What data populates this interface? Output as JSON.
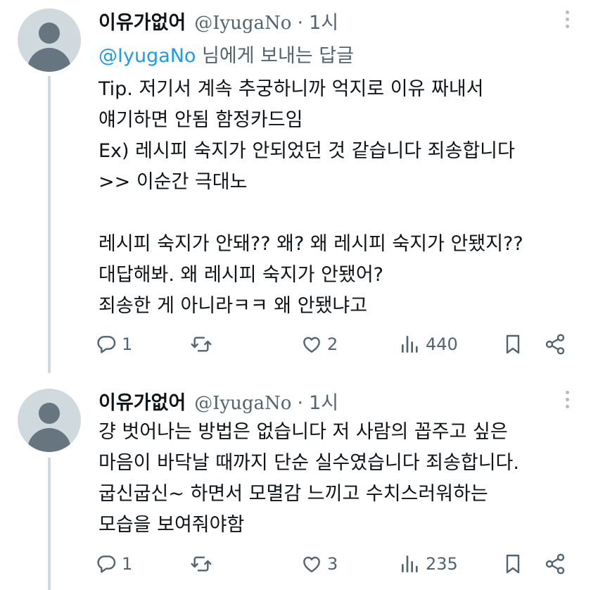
{
  "tweets": [
    {
      "author_name": "이유가없어",
      "author_handle": "@IyugaNo",
      "separator": "·",
      "time": "1시",
      "replying_to_mention": "@IyugaNo",
      "replying_to_suffix": " 님에게 보내는 답글",
      "lines": [
        "Tip. 저기서 계속 추궁하니까 억지로 이유 짜내서",
        "얘기하면 안됨 함정카드임",
        "Ex) 레시피 숙지가 안되었던 것 같습니다 죄송합니다",
        ">> 이순간 극대노",
        "",
        "레시피 숙지가 안돼?? 왜? 왜 레시피 숙지가 안됐지??",
        "대답해봐. 왜 레시피 숙지가 안됐어?",
        "죄송한 게 아니라ㅋㅋ 왜 안됐냐고"
      ],
      "replies": "1",
      "retweets": "",
      "likes": "2",
      "views": "440"
    },
    {
      "author_name": "이유가없어",
      "author_handle": "@IyugaNo",
      "separator": "·",
      "time": "1시",
      "lines": [
        "걍 벗어나는 방법은 없습니다 저 사람의 꼽주고 싶은",
        "마음이 바닥날 때까지 단순 실수였습니다 죄송합니다.",
        "굽신굽신~ 하면서 모멸감 느끼고 수치스러워하는",
        "모습을 보여줘야함"
      ],
      "replies": "1",
      "retweets": "",
      "likes": "3",
      "views": "235"
    }
  ],
  "icons": {
    "reply": "reply-icon",
    "retweet": "retweet-icon",
    "like": "heart-icon",
    "views": "views-icon",
    "bookmark": "bookmark-icon",
    "share": "share-icon",
    "more": "more-icon"
  },
  "colors": {
    "text": "#0f1419",
    "secondary": "#536471",
    "accent": "#1d9bf0",
    "thread_line": "#cfd9de"
  }
}
